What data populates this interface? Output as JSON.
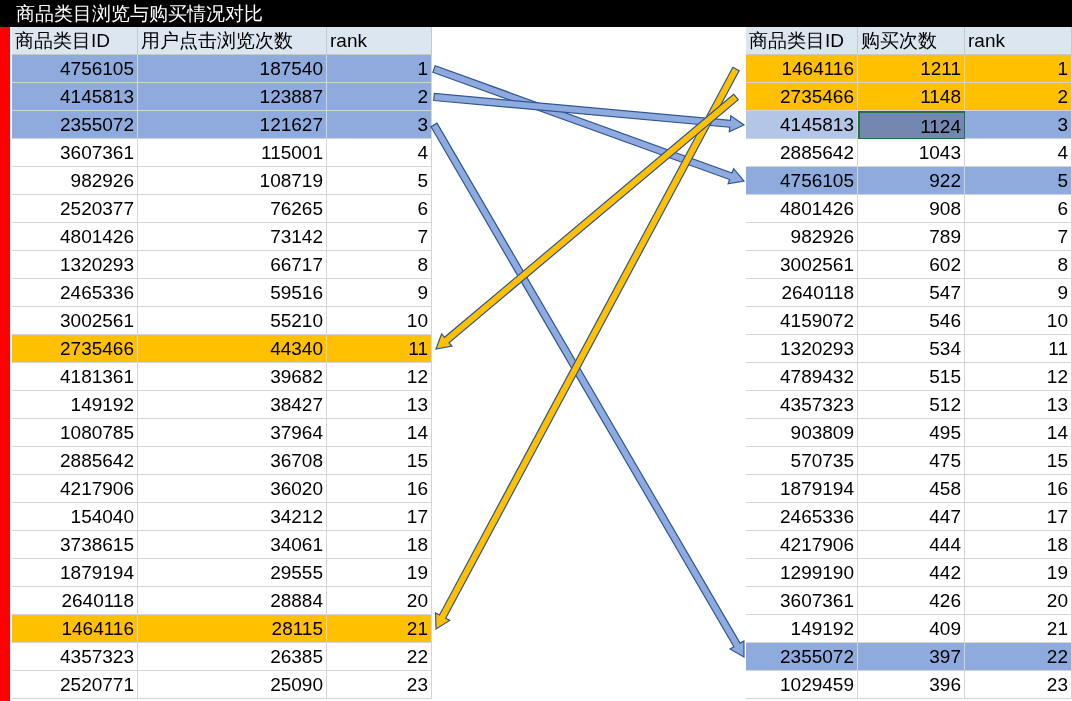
{
  "title": "商品类目浏览与购买情况对比",
  "left_table": {
    "columns": [
      "商品类目ID",
      "用户点击浏览次数",
      "rank"
    ],
    "rows": [
      {
        "cells": [
          "4756105",
          "187540",
          "1"
        ],
        "color": "#8faadc"
      },
      {
        "cells": [
          "4145813",
          "123887",
          "2"
        ],
        "color": "#8faadc"
      },
      {
        "cells": [
          "2355072",
          "121627",
          "3"
        ],
        "color": "#8faadc"
      },
      {
        "cells": [
          "3607361",
          "115001",
          "4"
        ]
      },
      {
        "cells": [
          "982926",
          "108719",
          "5"
        ]
      },
      {
        "cells": [
          "2520377",
          "76265",
          "6"
        ]
      },
      {
        "cells": [
          "4801426",
          "73142",
          "7"
        ]
      },
      {
        "cells": [
          "1320293",
          "66717",
          "8"
        ]
      },
      {
        "cells": [
          "2465336",
          "59516",
          "9"
        ]
      },
      {
        "cells": [
          "3002561",
          "55210",
          "10"
        ]
      },
      {
        "cells": [
          "2735466",
          "44340",
          "11"
        ],
        "color": "#ffc000"
      },
      {
        "cells": [
          "4181361",
          "39682",
          "12"
        ]
      },
      {
        "cells": [
          "149192",
          "38427",
          "13"
        ]
      },
      {
        "cells": [
          "1080785",
          "37964",
          "14"
        ]
      },
      {
        "cells": [
          "2885642",
          "36708",
          "15"
        ]
      },
      {
        "cells": [
          "4217906",
          "36020",
          "16"
        ]
      },
      {
        "cells": [
          "154040",
          "34212",
          "17"
        ]
      },
      {
        "cells": [
          "3738615",
          "34061",
          "18"
        ]
      },
      {
        "cells": [
          "1879194",
          "29555",
          "19"
        ]
      },
      {
        "cells": [
          "2640118",
          "28884",
          "20"
        ]
      },
      {
        "cells": [
          "1464116",
          "28115",
          "21"
        ],
        "color": "#ffc000"
      },
      {
        "cells": [
          "4357323",
          "26385",
          "22"
        ]
      },
      {
        "cells": [
          "2520771",
          "25090",
          "23"
        ]
      }
    ]
  },
  "right_table": {
    "columns": [
      "商品类目ID",
      "购买次数",
      "rank"
    ],
    "rows": [
      {
        "cells": [
          "1464116",
          "1211",
          "1"
        ],
        "color": "#ffc000",
        "selected": false
      },
      {
        "cells": [
          "2735466",
          "1148",
          "2"
        ],
        "color": "#ffc000",
        "selected": false
      },
      {
        "cells": [
          "4145813",
          "1124",
          "3"
        ],
        "color": "#8faadc",
        "selected": true
      },
      {
        "cells": [
          "2885642",
          "1043",
          "4"
        ],
        "selected": false
      },
      {
        "cells": [
          "4756105",
          "922",
          "5"
        ],
        "color": "#8faadc",
        "selected": false
      },
      {
        "cells": [
          "4801426",
          "908",
          "6"
        ],
        "selected": false
      },
      {
        "cells": [
          "982926",
          "789",
          "7"
        ],
        "selected": false
      },
      {
        "cells": [
          "3002561",
          "602",
          "8"
        ],
        "selected": false
      },
      {
        "cells": [
          "2640118",
          "547",
          "9"
        ],
        "selected": false
      },
      {
        "cells": [
          "4159072",
          "546",
          "10"
        ],
        "selected": false
      },
      {
        "cells": [
          "1320293",
          "534",
          "11"
        ],
        "selected": false
      },
      {
        "cells": [
          "4789432",
          "515",
          "12"
        ],
        "selected": false
      },
      {
        "cells": [
          "4357323",
          "512",
          "13"
        ],
        "selected": false
      },
      {
        "cells": [
          "903809",
          "495",
          "14"
        ],
        "selected": false
      },
      {
        "cells": [
          "570735",
          "475",
          "15"
        ],
        "selected": false
      },
      {
        "cells": [
          "1879194",
          "458",
          "16"
        ],
        "selected": false
      },
      {
        "cells": [
          "2465336",
          "447",
          "17"
        ],
        "selected": false
      },
      {
        "cells": [
          "4217906",
          "444",
          "18"
        ],
        "selected": false
      },
      {
        "cells": [
          "1299190",
          "442",
          "19"
        ],
        "selected": false
      },
      {
        "cells": [
          "3607361",
          "426",
          "20"
        ],
        "selected": false
      },
      {
        "cells": [
          "149192",
          "409",
          "21"
        ],
        "selected": false
      },
      {
        "cells": [
          "2355072",
          "397",
          "22"
        ],
        "color": "#8faadc",
        "selected": false
      },
      {
        "cells": [
          "1029459",
          "396",
          "23"
        ],
        "selected": false
      }
    ]
  },
  "arrows": [
    {
      "color": "#8faadc"
    },
    {
      "color": "#8faadc"
    },
    {
      "color": "#8faadc"
    },
    {
      "color": "#ffc000"
    },
    {
      "color": "#ffc000"
    }
  ]
}
